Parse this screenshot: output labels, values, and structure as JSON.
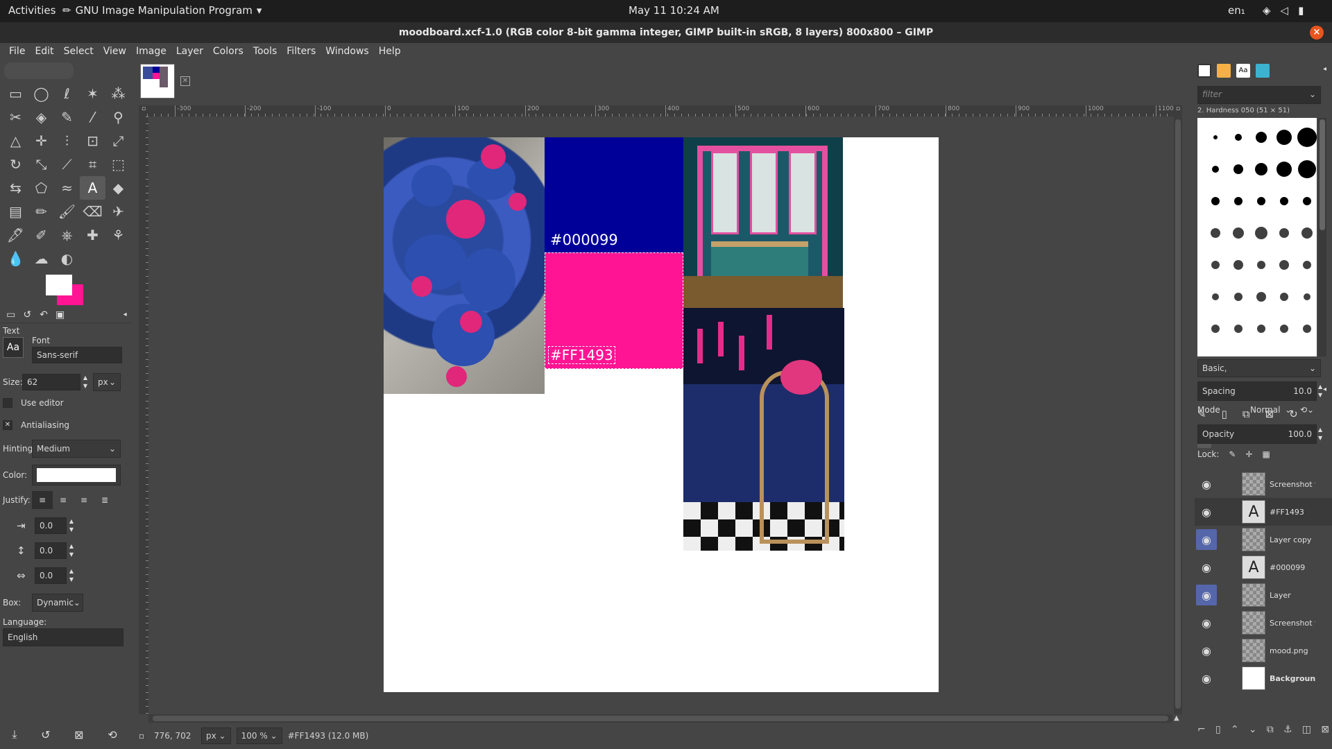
{
  "topbar": {
    "activities": "Activities",
    "app_name": "GNU Image Manipulation Program",
    "clock": "May 11  10:24 AM",
    "lang": "en₁",
    "icons": [
      "wifi-icon",
      "volume-icon",
      "battery-icon"
    ]
  },
  "window": {
    "title": "moodboard.xcf-1.0 (RGB color 8-bit gamma integer, GIMP built-in sRGB, 8 layers) 800x800 – GIMP",
    "close": "×"
  },
  "menu": [
    "File",
    "Edit",
    "Select",
    "View",
    "Image",
    "Layer",
    "Colors",
    "Tools",
    "Filters",
    "Windows",
    "Help"
  ],
  "toolbox": {
    "tools": [
      "rect-select-icon",
      "ellipse-select-icon",
      "free-select-icon",
      "fuzzy-select-icon",
      "color-select-icon",
      "scissors-icon",
      "foreground-select-icon",
      "paths-icon",
      "color-picker-icon",
      "zoom-icon",
      "measure-icon",
      "move-icon",
      "align-icon",
      "crop-icon",
      "unified-transform-icon",
      "rotate-icon",
      "scale-icon",
      "shear-icon",
      "perspective-icon",
      "3d-transform-icon",
      "warp-icon",
      "cage-icon",
      "smudge-warp-icon",
      "text-icon",
      "bucket-fill-icon",
      "gradient-icon",
      "pencil-icon",
      "paintbrush-icon",
      "eraser-icon",
      "airbrush-icon",
      "ink-icon",
      "mypaint-icon",
      "clone-icon",
      "heal-icon",
      "perspective-clone-icon",
      "blur-icon",
      "smudge-icon",
      "dodge-burn-icon"
    ],
    "tool_glyphs": [
      "▭",
      "◯",
      "ℓ",
      "✶",
      "⁂",
      "✂",
      "◈",
      "✎",
      "⁄",
      "⚲",
      "△",
      "✛",
      "⫶",
      "⊡",
      "⤢",
      "↻",
      "⤡",
      "⟋",
      "⌗",
      "⬚",
      "⇆",
      "⬠",
      "≈",
      "A",
      "◆",
      "▤",
      "✏",
      "🖌",
      "⌫",
      "✈",
      "🖋",
      "✐",
      "⎈",
      "✚",
      "⚘",
      "💧",
      "☁",
      "◐"
    ],
    "active_tool_index": 23,
    "fg_color": "#ffffff",
    "bg_color": "#ff1493"
  },
  "tool_options": {
    "tab_icons": [
      "▭",
      "↺",
      "↶",
      "▣"
    ],
    "title": "Text",
    "font_label": "Font",
    "font_value": "Sans-serif",
    "size_label": "Size:",
    "size_value": "62",
    "size_unit": "px",
    "use_editor": "Use editor",
    "antialiasing": "Antialiasing",
    "hinting_label": "Hinting:",
    "hinting_value": "Medium",
    "color_label": "Color:",
    "text_color": "#ffffff",
    "justify_label": "Justify:",
    "indent_value": "0.0",
    "line_spacing_value": "0.0",
    "letter_spacing_value": "0.0",
    "box_label": "Box:",
    "box_value": "Dynamic",
    "language_label": "Language:",
    "language_value": "English"
  },
  "rulers": {
    "h_ticks": [
      "-300",
      "-200",
      "-100",
      "0",
      "100",
      "200",
      "300",
      "400",
      "500",
      "600",
      "700",
      "800",
      "900",
      "1000",
      "1100"
    ]
  },
  "canvas": {
    "blue_label": "#000099",
    "pink_label": "#FF1493",
    "blue_color": "#000099",
    "pink_color": "#ff1493"
  },
  "statusbar": {
    "coords": "776, 702",
    "unit": "px",
    "zoom": "100 %",
    "info": "#FF1493 (12.0 MB)"
  },
  "brushes_panel": {
    "filter_placeholder": "filter",
    "brush_name": "2. Hardness 050 (51 × 51)",
    "preset": "Basic,",
    "spacing_label": "Spacing",
    "spacing_value": "10.0"
  },
  "layers_panel": {
    "mode_label": "Mode",
    "mode_value": "Normal",
    "opacity_label": "Opacity",
    "opacity_value": "100.0",
    "lock_label": "Lock:",
    "layers": [
      {
        "name": "Screenshot f",
        "text_layer": false,
        "highlight": false,
        "selected": false
      },
      {
        "name": "#FF1493",
        "text_layer": true,
        "highlight": false,
        "selected": true
      },
      {
        "name": "Layer copy",
        "text_layer": false,
        "highlight": true,
        "selected": false
      },
      {
        "name": "#000099",
        "text_layer": true,
        "highlight": false,
        "selected": false
      },
      {
        "name": "Layer",
        "text_layer": false,
        "highlight": true,
        "selected": false
      },
      {
        "name": "Screenshot f",
        "text_layer": false,
        "highlight": false,
        "selected": false
      },
      {
        "name": "mood.png",
        "text_layer": false,
        "highlight": false,
        "selected": false
      },
      {
        "name": "Background",
        "text_layer": false,
        "highlight": false,
        "selected": false
      }
    ]
  }
}
